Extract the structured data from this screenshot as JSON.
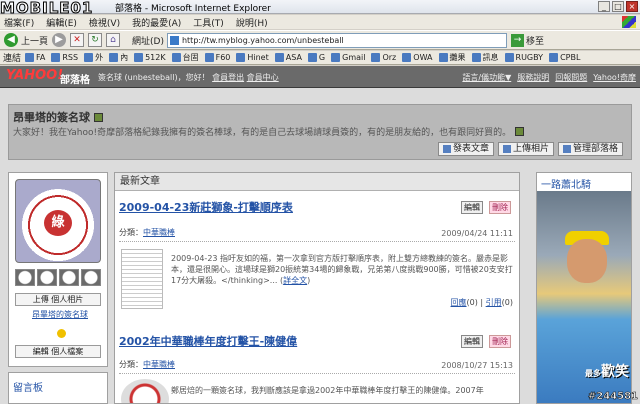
{
  "window": {
    "overlay_logo": "MOBILE01",
    "title": "部落格 - Microsoft Internet Explorer"
  },
  "menu": [
    "檔案(F)",
    "編輯(E)",
    "檢視(V)",
    "我的最愛(A)",
    "工具(T)",
    "說明(H)"
  ],
  "toolbar": {
    "back": "上一頁",
    "address_label": "網址(D)",
    "url": "http://tw.myblog.yahoo.com/unbesteball",
    "go": "移至"
  },
  "links": {
    "title": "連結",
    "items": [
      "FA",
      "RSS",
      "外",
      "內",
      "512K",
      "台固",
      "F60",
      "Hinet",
      "ASA",
      "G",
      "Gmail",
      "Orz",
      "OWA",
      "攤果",
      "訊息",
      "RUGBY",
      "CPBL"
    ]
  },
  "ynav": {
    "logo": "YAHOO!",
    "logo_sub": "部落格",
    "user_prefix": "簽名球 (unbesteball)，您好！",
    "user_links": [
      "會員登出",
      "會員中心"
    ],
    "right_links": [
      "語言/儀功能▼",
      "服務說明",
      "回報問題",
      "Yahoo!奇摩"
    ]
  },
  "blog": {
    "title": "昂畢塔的簽名球",
    "description": "大家好！我在Yahoo!奇摩部落格紀錄我擁有的簽名棒球，有的是自己去球場請球員簽的，有的是朋友給的，也有跟同好買的。",
    "actions": [
      "發表文章",
      "上傳相片",
      "管理部落格"
    ]
  },
  "profile": {
    "seal_text": "綠",
    "upload_photo": "上傳 個人相片",
    "name_link": "昂畢塔的簽名球",
    "edit_profile": "編輯 個人檔案"
  },
  "sidebar": {
    "guestbook_title": "留言板"
  },
  "main": {
    "section_title": "最新文章",
    "posts": [
      {
        "title": "2009-04-23新莊獅象-打擊順序表",
        "edit": "編輯",
        "delete": "刪除",
        "category_label": "分類：",
        "category": "中華職棒",
        "date": "2009/04/24 11:11",
        "body": "2009-04-23 指吁友如的福，第一次拿到官方版打擊順序表，附上雙方總教練的簽名。嚴赤是影本，還是很開心。這場球是獅20振統第34場的歸象戰，兄弟第八度挑戰900勝，可惜被20支安打17分大屠殺。</thinking>...",
        "more": "詳全文",
        "stat_reply": "回應",
        "reply_count": "(0)",
        "stat_quote": "引用",
        "quote_count": "(0)"
      },
      {
        "title": "2002年中華職棒年度打擊王-陳健偉",
        "edit": "編輯",
        "delete": "刪除",
        "category_label": "分類：",
        "category": "中華職棒",
        "date": "2008/10/27 15:13",
        "body": "鄭居焙的一顆簽名球，我判斷應該是拿過2002年中華職棒年度打擊王的陳健偉。2007年"
      }
    ]
  },
  "right": {
    "title": "一路蕭北騎",
    "caption": "歡笑",
    "caption_small": "最多"
  },
  "watermark": "#244581"
}
